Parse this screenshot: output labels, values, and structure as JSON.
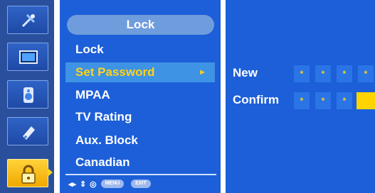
{
  "sidebar": {
    "icons": [
      {
        "name": "antenna-icon"
      },
      {
        "name": "picture-icon"
      },
      {
        "name": "audio-icon"
      },
      {
        "name": "settings-icon"
      },
      {
        "name": "lock-icon",
        "active": true
      }
    ]
  },
  "menu": {
    "title": "Lock",
    "items": [
      {
        "label": "Lock"
      },
      {
        "label": "Set Password",
        "selected": true,
        "arrow": "►"
      },
      {
        "label": "MPAA"
      },
      {
        "label": "TV Rating"
      },
      {
        "label": "Aux. Block"
      },
      {
        "label": "Canadian"
      }
    ],
    "hints": {
      "arrows_lr": "◂▸",
      "arrows_ud": "⇕",
      "ok": "◎",
      "menu_label": "MENU",
      "exit_label": "EXIT"
    }
  },
  "password": {
    "new_label": "New",
    "confirm_label": "Confirm",
    "new_digits": [
      "*",
      "*",
      "*",
      "*"
    ],
    "confirm_digits": [
      "*",
      "*",
      "*",
      ""
    ]
  },
  "colors": {
    "panel": "#1d5fd8",
    "selected_bg": "#3f93e4",
    "highlight_text": "#ffd21a",
    "cursor": "#ffd400"
  }
}
